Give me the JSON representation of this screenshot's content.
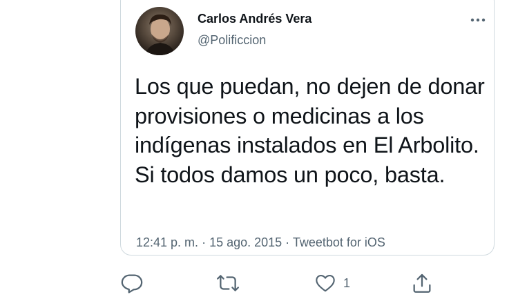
{
  "tweet": {
    "display_name": "Carlos Andrés Vera",
    "handle": "@Polificcion",
    "text": "Los que puedan, no dejen de donar provisiones o medicinas a los indígenas instalados en El Arbolito. Si todos damos un poco, basta.",
    "time": "12:41 p. m.",
    "separator_1": " · ",
    "date": "15 ago. 2015",
    "separator_2": " · ",
    "source": "Tweetbot for iOS"
  },
  "actions": {
    "reply_icon": "reply-icon",
    "retweet_icon": "retweet-icon",
    "like_icon": "heart-icon",
    "like_count": "1",
    "share_icon": "share-icon"
  },
  "colors": {
    "text": "#0f1419",
    "secondary": "#536471",
    "border": "#cfd9de"
  }
}
